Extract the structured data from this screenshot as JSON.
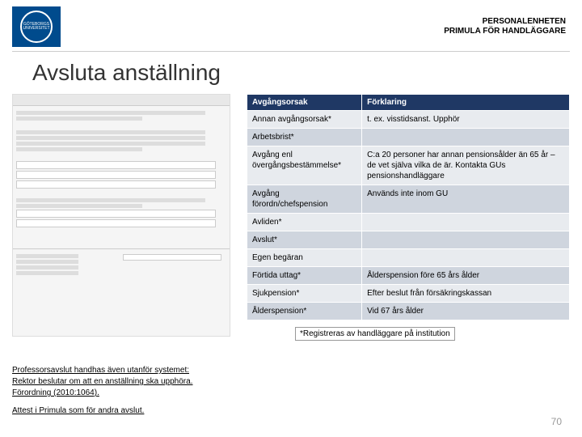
{
  "header": {
    "org_line1": "GÖTEBORGS",
    "org_line2": "UNIVERSITET",
    "right_line1": "PERSONALENHETEN",
    "right_line2": "PRIMULA FÖR HANDLÄGGARE"
  },
  "title": "Avsluta anställning",
  "table": {
    "head": {
      "c1": "Avgångsorsak",
      "c2": "Förklaring"
    },
    "rows": [
      {
        "c1": "Annan avgångsorsak*",
        "c2": "t. ex. visstidsanst. Upphör"
      },
      {
        "c1": "Arbetsbrist*",
        "c2": ""
      },
      {
        "c1": "Avgång enl övergångsbestämmelse*",
        "c2": "C:a 20 personer har annan pensionsålder än 65 år – de vet själva vilka de är. Kontakta GUs pensionshandläggare"
      },
      {
        "c1": "Avgång förordn/chefspension",
        "c2": "Används inte inom GU"
      },
      {
        "c1": "Avliden*",
        "c2": ""
      },
      {
        "c1": "Avslut*",
        "c2": ""
      },
      {
        "c1": "Egen begäran",
        "c2": ""
      },
      {
        "c1": "Förtida uttag*",
        "c2": "Ålderspension före 65 års ålder"
      },
      {
        "c1": "Sjukpension*",
        "c2": "Efter beslut från försäkringskassan"
      },
      {
        "c1": "Ålderspension*",
        "c2": "Vid 67 års ålder"
      }
    ]
  },
  "notes": {
    "p1a": "Professorsavslut handhas även utanför systemet:",
    "p1b": "Rektor beslutar om att en anställning ska upphöra.",
    "p1c": "Förordning (2010:1064).",
    "p2": "Attest i Primula som för andra avslut."
  },
  "footnote": "*Registreras av handläggare på institution",
  "page_number": "70"
}
